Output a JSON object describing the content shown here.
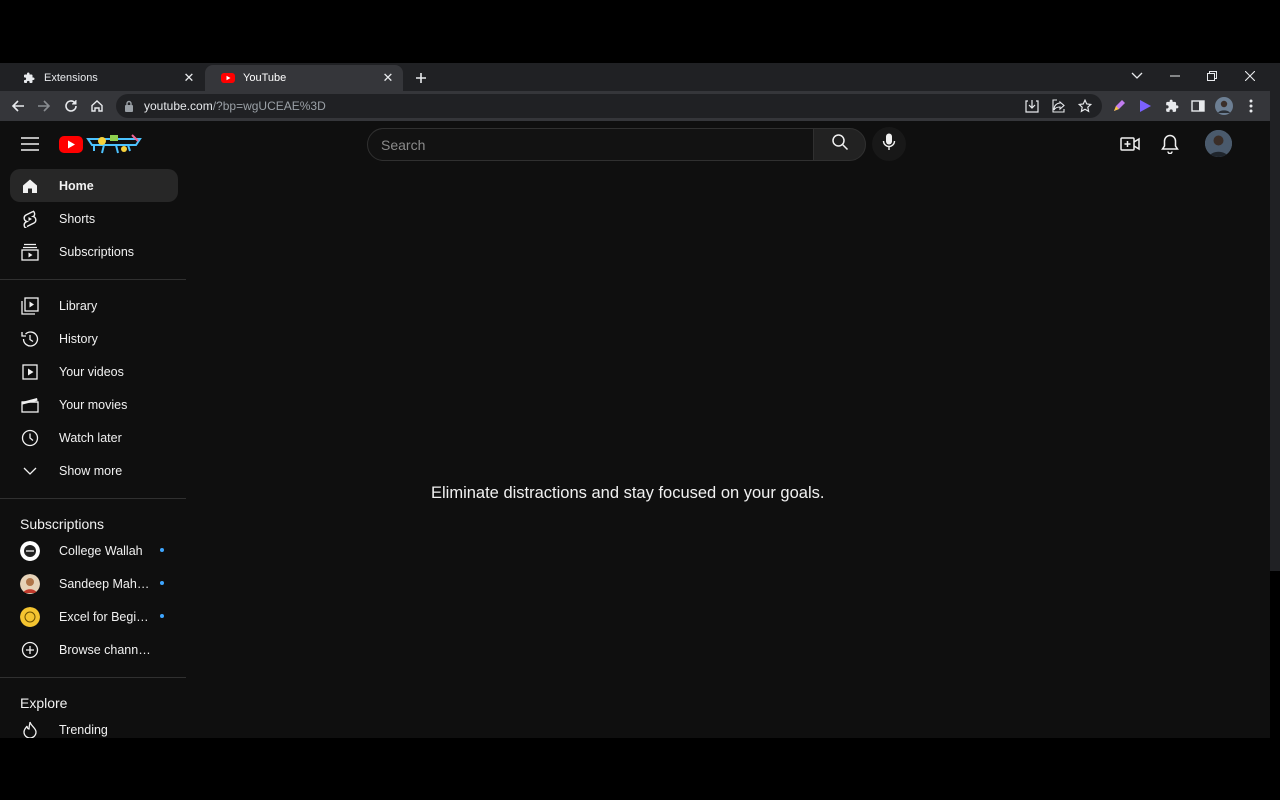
{
  "browser": {
    "tabs": [
      {
        "title": "Extensions",
        "icon": "puzzle-icon",
        "active": false
      },
      {
        "title": "YouTube",
        "icon": "youtube-favicon",
        "active": true
      }
    ],
    "url_host": "youtube.com",
    "url_path": "/?bp=wgUCEAE%3D"
  },
  "youtube": {
    "search_placeholder": "Search",
    "sidebar": {
      "main": [
        {
          "label": "Home",
          "icon": "home-icon"
        },
        {
          "label": "Shorts",
          "icon": "shorts-icon"
        },
        {
          "label": "Subscriptions",
          "icon": "subscriptions-icon"
        }
      ],
      "library": [
        {
          "label": "Library",
          "icon": "library-icon"
        },
        {
          "label": "History",
          "icon": "history-icon"
        },
        {
          "label": "Your videos",
          "icon": "your-videos-icon"
        },
        {
          "label": "Your movies",
          "icon": "movies-icon"
        },
        {
          "label": "Watch later",
          "icon": "clock-icon"
        },
        {
          "label": "Show more",
          "icon": "chevron-down-icon"
        }
      ],
      "subscriptions_heading": "Subscriptions",
      "subscriptions": [
        {
          "label": "College Wallah"
        },
        {
          "label": "Sandeep Mahes..."
        },
        {
          "label": "Excel for Beginn..."
        },
        {
          "label": "Browse channels"
        }
      ],
      "explore_heading": "Explore",
      "explore": [
        {
          "label": "Trending"
        }
      ]
    },
    "message": "Eliminate distractions and stay focused on your goals."
  },
  "colors": {
    "accent_red": "#ff0000",
    "unread_dot": "#3ea6ff",
    "background": "#0f0f0f"
  }
}
